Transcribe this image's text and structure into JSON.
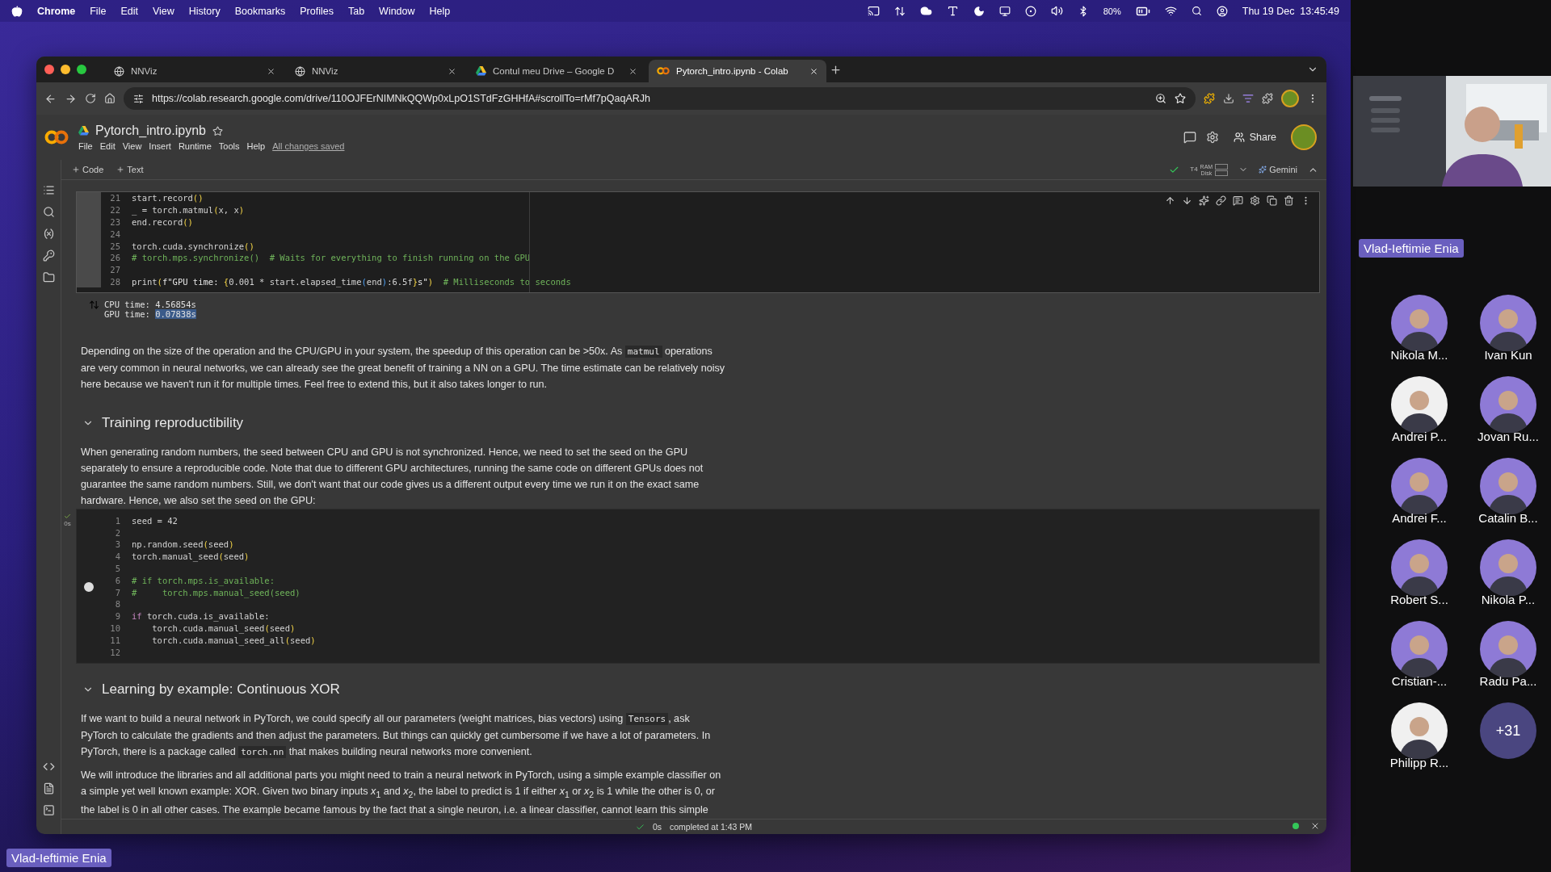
{
  "menubar": {
    "app": "Chrome",
    "menus": [
      "File",
      "Edit",
      "View",
      "History",
      "Bookmarks",
      "Profiles",
      "Tab",
      "Window",
      "Help"
    ],
    "battery": "80%",
    "clock": "Thu 19 Dec  13:45:49"
  },
  "browser": {
    "tabs": [
      {
        "title": "NNViz",
        "selected": false
      },
      {
        "title": "NNViz",
        "selected": false
      },
      {
        "title": "Contul meu Drive – Google D",
        "selected": false
      },
      {
        "title": "Pytorch_intro.ipynb - Colab",
        "selected": true
      }
    ],
    "url": "https://colab.research.google.com/drive/110OJFErNIMNkQQWp0xLpO1STdFzGHHfA#scrollTo=rMf7pQaqARJh"
  },
  "notebook": {
    "title": "Pytorch_intro.ipynb",
    "menus": [
      "File",
      "Edit",
      "View",
      "Insert",
      "Runtime",
      "Tools",
      "Help"
    ],
    "save_status": "All changes saved",
    "share": "Share",
    "add_buttons": [
      "Code",
      "Text"
    ],
    "runtime": {
      "gpu": "T4",
      "ram": "RAM",
      "disk": "Disk"
    },
    "gemini": "Gemini",
    "cells": [
      {
        "kind": "code",
        "focused": true,
        "run_button": false,
        "lines": [
          {
            "number": "21",
            "parts": [
              {
                "text": "start.record",
                "kind": "plain"
              },
              {
                "text": "()",
                "kind": "bracket"
              }
            ]
          },
          {
            "number": "22",
            "parts": [
              {
                "text": "_ = torch.matmul",
                "kind": "plain"
              },
              {
                "text": "(",
                "kind": "bracket"
              },
              {
                "text": "x, x",
                "kind": "plain"
              },
              {
                "text": ")",
                "kind": "bracket"
              }
            ]
          },
          {
            "number": "23",
            "parts": [
              {
                "text": "end.record",
                "kind": "plain"
              },
              {
                "text": "()",
                "kind": "bracket"
              }
            ]
          },
          {
            "number": "24"
          },
          {
            "number": "25",
            "parts": [
              {
                "text": "torch.cuda.synchronize",
                "kind": "plain"
              },
              {
                "text": "()",
                "kind": "bracket"
              }
            ]
          },
          {
            "number": "26",
            "parts": [
              {
                "text": "# torch.mps.synchronize()  # Waits for everything to finish running on the GPU",
                "kind": "comment"
              }
            ]
          },
          {
            "number": "27"
          },
          {
            "number": "28",
            "parts": [
              {
                "text": "print",
                "kind": "plain"
              },
              {
                "text": "(",
                "kind": "bracket"
              },
              {
                "text": "f\"GPU time: ",
                "kind": "string"
              },
              {
                "text": "{",
                "kind": "bracket"
              },
              {
                "text": "0.001 * start.elapsed_time",
                "kind": "plain"
              },
              {
                "text": "(",
                "kind": "inner"
              },
              {
                "text": "end",
                "kind": "plain"
              },
              {
                "text": ")",
                "kind": "inner"
              },
              {
                "text": ":6.5f",
                "kind": "plain"
              },
              {
                "text": "}",
                "kind": "bracket"
              },
              {
                "text": "s\"",
                "kind": "string"
              },
              {
                "text": ")",
                "kind": "bracket"
              },
              {
                "text": "  # Milliseconds to seconds",
                "kind": "comment"
              }
            ]
          }
        ],
        "output": [
          [
            {
              "text": "CPU time: 4.56854s",
              "selected": false
            }
          ],
          [
            {
              "text": "GPU time: ",
              "selected": false
            },
            {
              "text": "0.07838s",
              "selected": true
            }
          ]
        ]
      },
      {
        "kind": "text",
        "paragraphs": [
          [
            {
              "text": "Depending on the size of the operation and the CPU/GPU in your system, the speedup of this operation can be >50x. As ",
              "kind": "text"
            },
            {
              "text": "matmul",
              "kind": "code"
            },
            {
              "text": " operations are very common in neural networks, we can already see the great benefit of training a NN on a GPU. The time estimate can be relatively noisy here because we haven't run it for multiple times. Feel free to extend this, but it also takes longer to run.",
              "kind": "text"
            }
          ]
        ]
      },
      {
        "kind": "heading",
        "text": "Training reproductibility",
        "expanded": true
      },
      {
        "kind": "text",
        "paragraphs": [
          [
            {
              "text": "When generating random numbers, the seed between CPU and GPU is not synchronized. Hence, we need to set the seed on the GPU separately to ensure a reproducible code. Note that due to different GPU architectures, running the same code on different GPUs does not guarantee the same random numbers. Still, we don't want that our code gives us a different output every time we run it on the exact same hardware. Hence, we also set the seed on the GPU:",
              "kind": "text"
            }
          ]
        ]
      },
      {
        "kind": "code",
        "focused": false,
        "run_button": true,
        "exec_time": "0s",
        "lines": [
          {
            "number": "1",
            "parts": [
              {
                "text": "seed = 42",
                "kind": "plain"
              }
            ]
          },
          {
            "number": "2"
          },
          {
            "number": "3",
            "parts": [
              {
                "text": "np.random.seed",
                "kind": "plain"
              },
              {
                "text": "(",
                "kind": "bracket"
              },
              {
                "text": "seed",
                "kind": "plain"
              },
              {
                "text": ")",
                "kind": "bracket"
              }
            ]
          },
          {
            "number": "4",
            "parts": [
              {
                "text": "torch.manual_seed",
                "kind": "plain"
              },
              {
                "text": "(",
                "kind": "bracket"
              },
              {
                "text": "seed",
                "kind": "plain"
              },
              {
                "text": ")",
                "kind": "bracket"
              }
            ]
          },
          {
            "number": "5"
          },
          {
            "number": "6",
            "parts": [
              {
                "text": "# if torch.mps.is_available:",
                "kind": "comment"
              }
            ]
          },
          {
            "number": "7",
            "parts": [
              {
                "text": "#     torch.mps.manual_seed(seed)",
                "kind": "comment"
              }
            ]
          },
          {
            "number": "8"
          },
          {
            "number": "9",
            "parts": [
              {
                "text": "if",
                "kind": "keyword"
              },
              {
                "text": " torch.cuda.is_available:",
                "kind": "plain"
              }
            ]
          },
          {
            "number": "10",
            "parts": [
              {
                "text": "    torch.cuda.manual_seed",
                "kind": "plain"
              },
              {
                "text": "(",
                "kind": "bracket"
              },
              {
                "text": "seed",
                "kind": "plain"
              },
              {
                "text": ")",
                "kind": "bracket"
              }
            ]
          },
          {
            "number": "11",
            "parts": [
              {
                "text": "    torch.cuda.manual_seed_all",
                "kind": "plain"
              },
              {
                "text": "(",
                "kind": "bracket"
              },
              {
                "text": "seed",
                "kind": "plain"
              },
              {
                "text": ")",
                "kind": "bracket"
              }
            ]
          },
          {
            "number": "12"
          }
        ]
      },
      {
        "kind": "heading",
        "text": "Learning by example: Continuous XOR",
        "expanded": true
      },
      {
        "kind": "text",
        "paragraphs": [
          [
            {
              "text": "If we want to build a neural network in PyTorch, we could specify all our parameters (weight matrices, bias vectors) using ",
              "kind": "text"
            },
            {
              "text": "Tensors",
              "kind": "code"
            },
            {
              "text": ", ask PyTorch to calculate the gradients and then adjust the parameters. But things can quickly get cumbersome if we have a lot of parameters. In PyTorch, there is a package called ",
              "kind": "text"
            },
            {
              "text": "torch.nn",
              "kind": "code"
            },
            {
              "text": " that makes building neural networks more convenient.",
              "kind": "text"
            }
          ],
          [
            {
              "text": "We will introduce the libraries and all additional parts you might need to train a neural network in PyTorch, using a simple example classifier on a simple yet well known example: XOR. Given two binary inputs *x*$_{1}$ and *x*$_{2}$, the label to predict is 1 if either *x*$_{1}$ or *x*$_{2}$ is 1 while the other is 0, or the label is 0 in all other cases. The example became famous by the fact that a single neuron, i.e. a linear classifier, cannot learn this simple",
              "kind": "text"
            }
          ]
        ]
      }
    ],
    "status": {
      "exec_time": "0s",
      "completed": "completed at 1:43 PM"
    }
  },
  "meeting": {
    "presenter": "Vlad-Ieftimie Enia",
    "participants": [
      "Nikola M...",
      "Ivan Kun",
      "Andrei P...",
      "Jovan Ru...",
      "Andrei F...",
      "Catalin B...",
      "Robert S...",
      "Nikola P...",
      "Cristian-...",
      "Radu Pa...",
      "Philipp R..."
    ],
    "more": "+31",
    "speaker_tag": "Vlad-Ieftimie Enia"
  }
}
